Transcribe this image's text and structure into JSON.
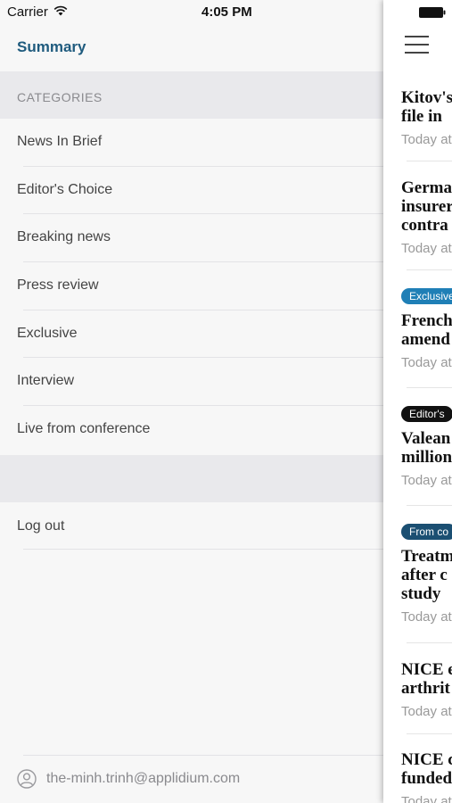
{
  "status_bar": {
    "carrier": "Carrier",
    "time": "4:05 PM"
  },
  "menu": {
    "summary_label": "Summary",
    "categories_header": "CATEGORIES",
    "items": [
      {
        "label": "News In Brief"
      },
      {
        "label": "Editor's Choice"
      },
      {
        "label": "Breaking news"
      },
      {
        "label": "Press review"
      },
      {
        "label": "Exclusive"
      },
      {
        "label": "Interview"
      },
      {
        "label": "Live from conference"
      }
    ],
    "logout_label": "Log out",
    "account_email": "the-minh.trinh@applidium.com"
  },
  "feed": {
    "articles": [
      {
        "badge": "",
        "headline_lines": [
          "Kitov's",
          "file in"
        ],
        "meta": "Today at"
      },
      {
        "badge": "",
        "headline_lines": [
          "Germa",
          "insurer",
          "contra"
        ],
        "meta": "Today at"
      },
      {
        "badge": "Exclusive",
        "badge_color": "#1f7fb6",
        "headline_lines": [
          "French",
          "amend"
        ],
        "meta": "Today at"
      },
      {
        "badge": "Editor's",
        "badge_color": "#111111",
        "headline_lines": [
          "Valean",
          "million"
        ],
        "meta": "Today at"
      },
      {
        "badge": "From co",
        "badge_color": "#1b4f72",
        "headline_lines": [
          "Treatm",
          "after c",
          "study"
        ],
        "meta": "Today at"
      },
      {
        "badge": "",
        "headline_lines": [
          "NICE e",
          "arthrit"
        ],
        "meta": "Today at"
      },
      {
        "badge": "",
        "headline_lines": [
          "NICE c",
          "funded"
        ],
        "meta": "Today at"
      }
    ]
  },
  "colors": {
    "accent": "#1f5b7e",
    "menu_bg": "#f7f7f7",
    "section_bg": "#e9e9ec"
  }
}
